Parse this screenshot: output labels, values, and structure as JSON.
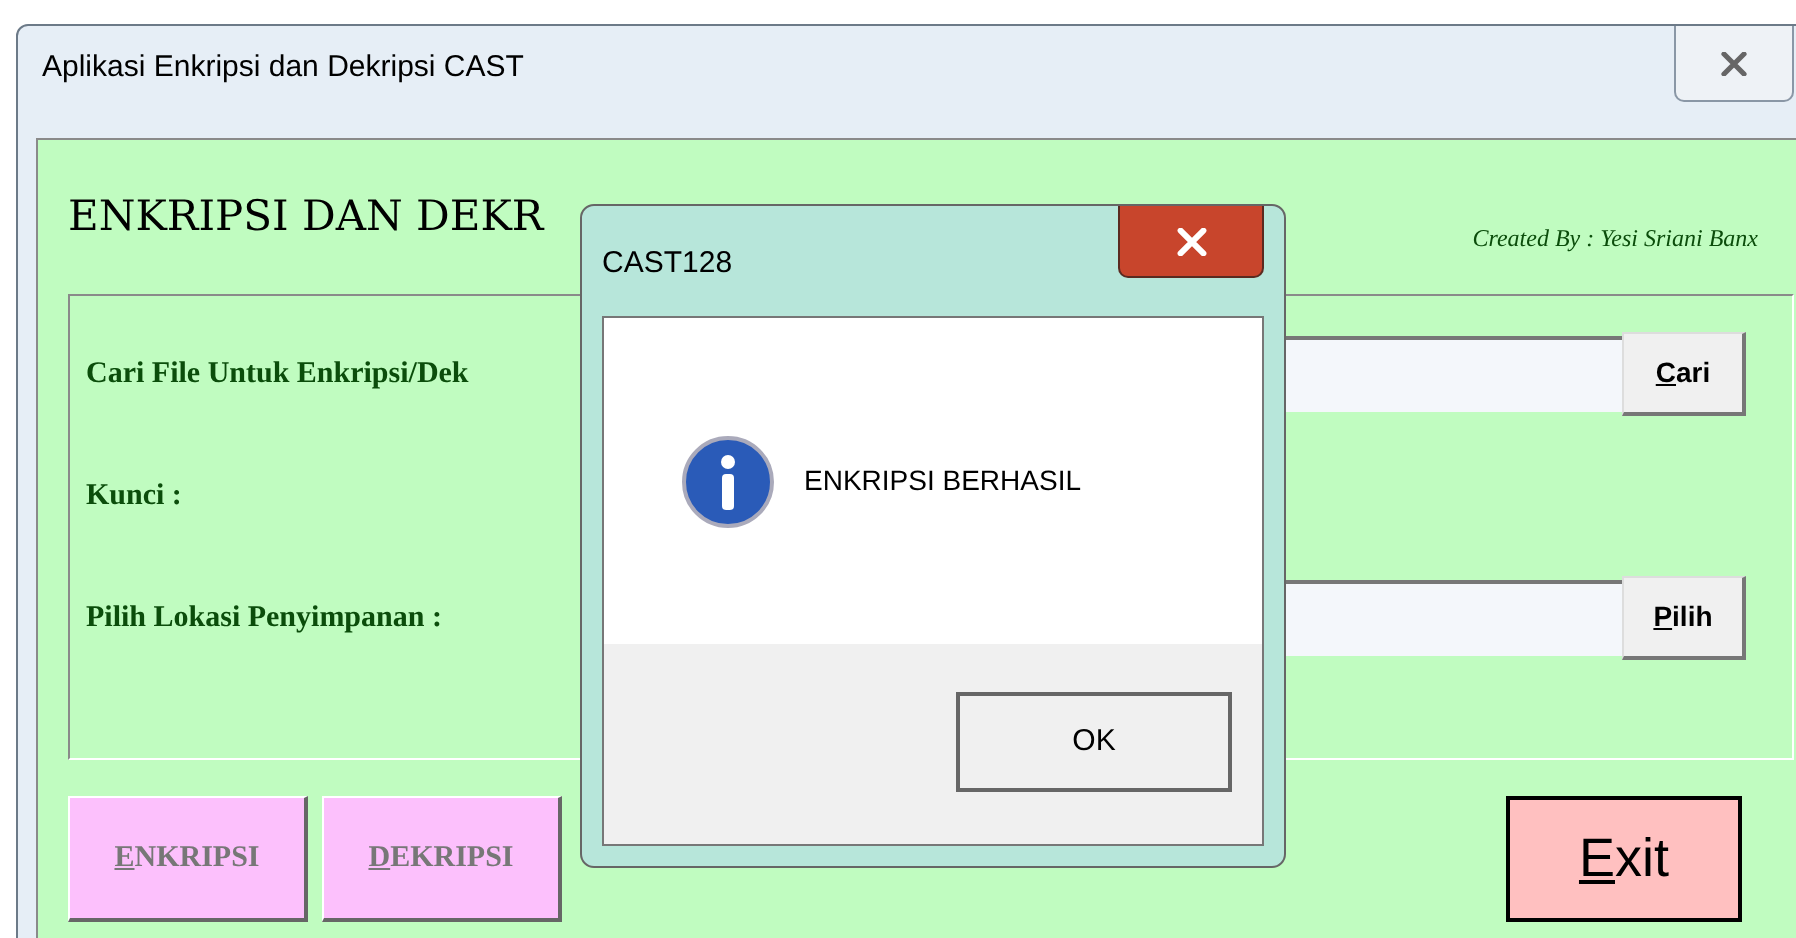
{
  "window": {
    "title": "Aplikasi Enkripsi dan Dekripsi CAST"
  },
  "heading": "ENKRIPSI DAN DEKR",
  "credit": "Created By : Yesi Sriani Banx",
  "form": {
    "rows": [
      {
        "kind": "field",
        "label": "Cari File Untuk Enkripsi/Dek",
        "button": "Cari"
      },
      {
        "kind": "label",
        "label": "Kunci :"
      },
      {
        "kind": "field",
        "label": "Pilih Lokasi Penyimpanan :",
        "button": "Pilih"
      }
    ]
  },
  "actions": [
    {
      "label": "ENKRIPSI"
    },
    {
      "label": "DEKRIPSI"
    }
  ],
  "exit_button": "Exit",
  "dialog": {
    "title": "CAST128",
    "message": "ENKRIPSI BERHASIL",
    "button": "OK"
  }
}
